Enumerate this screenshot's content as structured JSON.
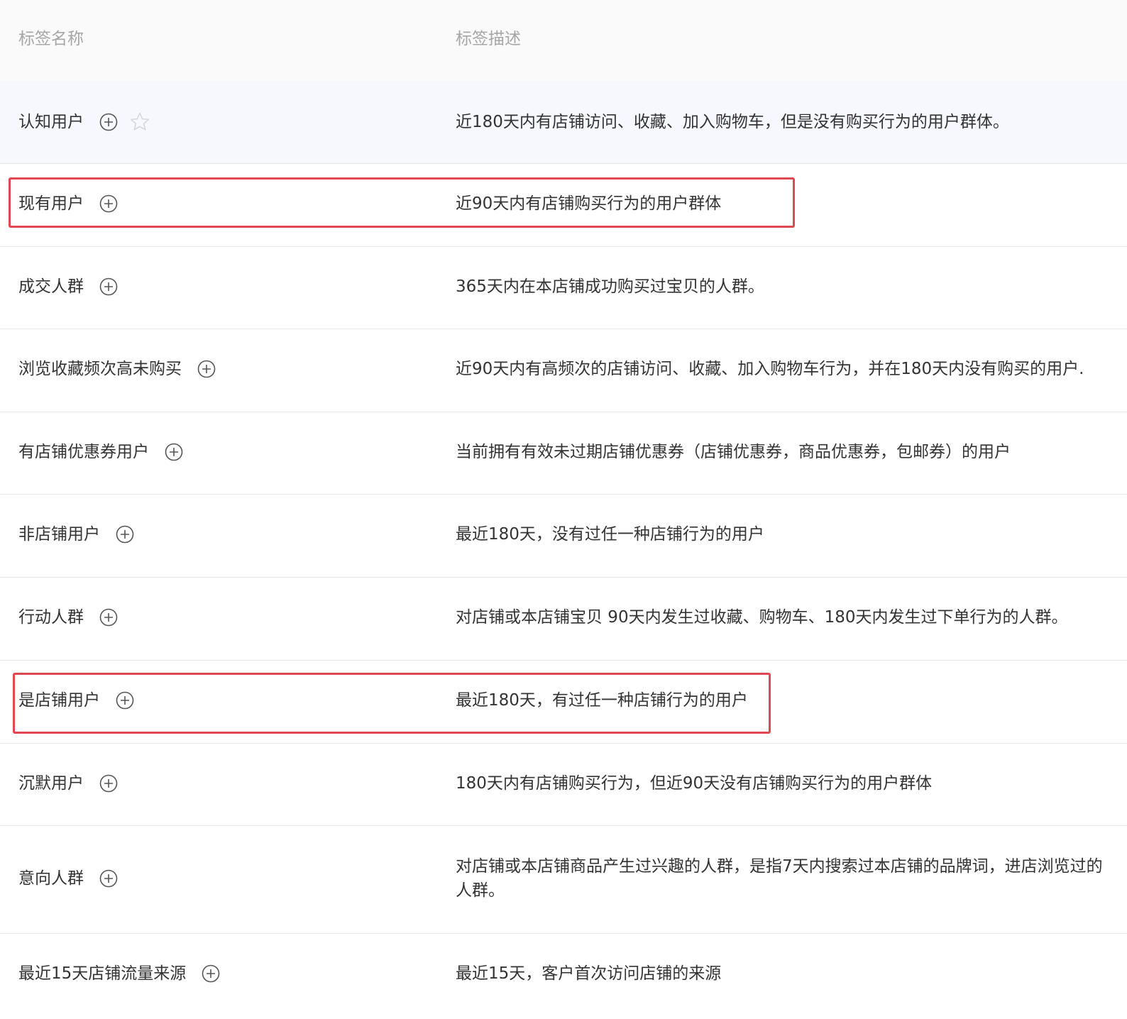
{
  "header": {
    "col_name": "标签名称",
    "col_desc": "标签描述"
  },
  "rows": [
    {
      "name": "认知用户",
      "desc": "近180天内有店铺访问、收藏、加入购物车，但是没有购买行为的用户群体。",
      "starred": false
    },
    {
      "name": "现有用户",
      "desc": "近90天内有店铺购买行为的用户群体"
    },
    {
      "name": "成交人群",
      "desc": "365天内在本店铺成功购买过宝贝的人群。"
    },
    {
      "name": "浏览收藏频次高未购买",
      "desc": "近90天内有高频次的店铺访问、收藏、加入购物车行为，并在180天内没有购买的用户."
    },
    {
      "name": "有店铺优惠券用户",
      "desc": "当前拥有有效未过期店铺优惠券（店铺优惠券，商品优惠券，包邮券）的用户"
    },
    {
      "name": "非店铺用户",
      "desc": "最近180天，没有过任一种店铺行为的用户"
    },
    {
      "name": "行动人群",
      "desc": "对店铺或本店铺宝贝 90天内发生过收藏、购物车、180天内发生过下单行为的人群。"
    },
    {
      "name": "是店铺用户",
      "desc": "最近180天，有过任一种店铺行为的用户"
    },
    {
      "name": "沉默用户",
      "desc": "180天内有店铺购买行为，但近90天没有店铺购买行为的用户群体"
    },
    {
      "name": "意向人群",
      "desc": "对店铺或本店铺商品产生过兴趣的人群，是指7天内搜索过本店铺的品牌词，进店浏览过的人群。"
    },
    {
      "name": "最近15天店铺流量来源",
      "desc": "最近15天，客户首次访问店铺的来源"
    }
  ],
  "icons": {
    "add": "plus-circle-icon",
    "favorite": "star-outline-icon"
  },
  "colors": {
    "highlight_border": "#e0474f",
    "header_bg": "#fafafa",
    "hover_row_bg": "#f7f8fd",
    "header_text": "#a6a6a6",
    "body_text": "#333333"
  },
  "highlighted_rows": [
    "现有用户",
    "是店铺用户"
  ]
}
